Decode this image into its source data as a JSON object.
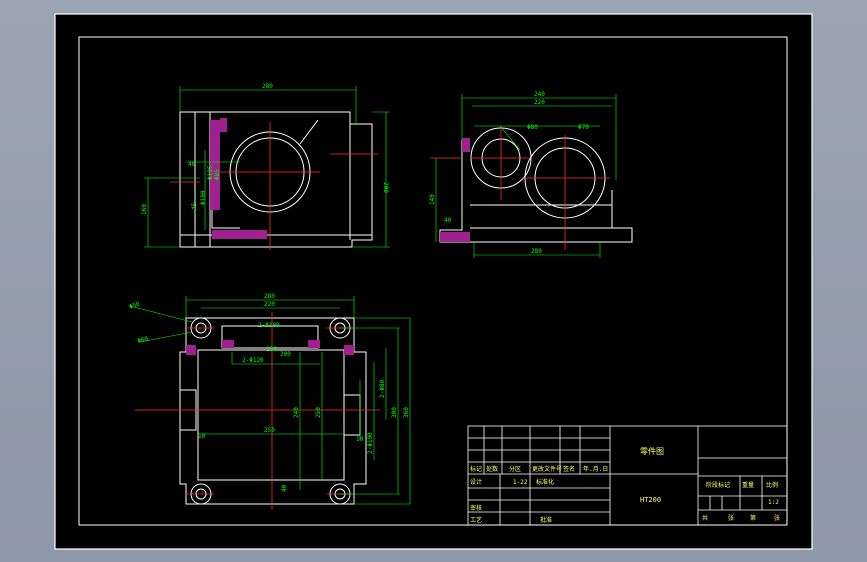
{
  "colors": {
    "background": "#000000",
    "frame": "#ffffff",
    "dimension": "#00ff00",
    "centerline": "#ff0000",
    "hatch": "#ff00ff",
    "text": "#ffffff",
    "title_text": "#ffff66"
  },
  "front_view": {
    "dims": {
      "overall_width": "280",
      "height_total": "200",
      "height_left": "160",
      "bore": "Φ100",
      "dia_a": "Φ105",
      "dia_b": "Φ85",
      "small_a": "40",
      "small_b": "45"
    }
  },
  "side_view": {
    "dims": {
      "top_a": "240",
      "top_b": "220",
      "left_bore": "Φ80",
      "right_bore": "Φ70",
      "height": "140",
      "base": "280",
      "small": "40"
    }
  },
  "plan_view": {
    "dims": {
      "top_a": "280",
      "top_b": "220",
      "hole_a": "Φ50",
      "hole_b": "Φ60",
      "holes_top": "2-Φ180",
      "holes_mid": "2-Φ120",
      "mid_a": "100",
      "mid_b": "200",
      "inner_w": "250",
      "height_a": "240",
      "height_b": "250",
      "right_a": "300",
      "right_b": "360",
      "right_c": "2-Φ100",
      "right_d": "2-Φ80",
      "small_a": "10",
      "small_b": "10",
      "small_c": "40"
    }
  },
  "title_block": {
    "part_name": "零件图",
    "drawing_no": "HT200",
    "row_labels": [
      "标记",
      "处数",
      "分区",
      "更改文件号",
      "签名",
      "年.月.日"
    ],
    "designer": "设计",
    "standard": "标准化",
    "checker": "审核",
    "process": "工艺",
    "approve": "批准",
    "stage": "阶段标记",
    "weight": "重量",
    "scale_label": "比例",
    "scale": "1:2",
    "sheets_label_a": "共",
    "sheets_label_b": "张",
    "sheet_label_a": "第",
    "sheet_label_b": "张",
    "date_a": "1-22"
  }
}
